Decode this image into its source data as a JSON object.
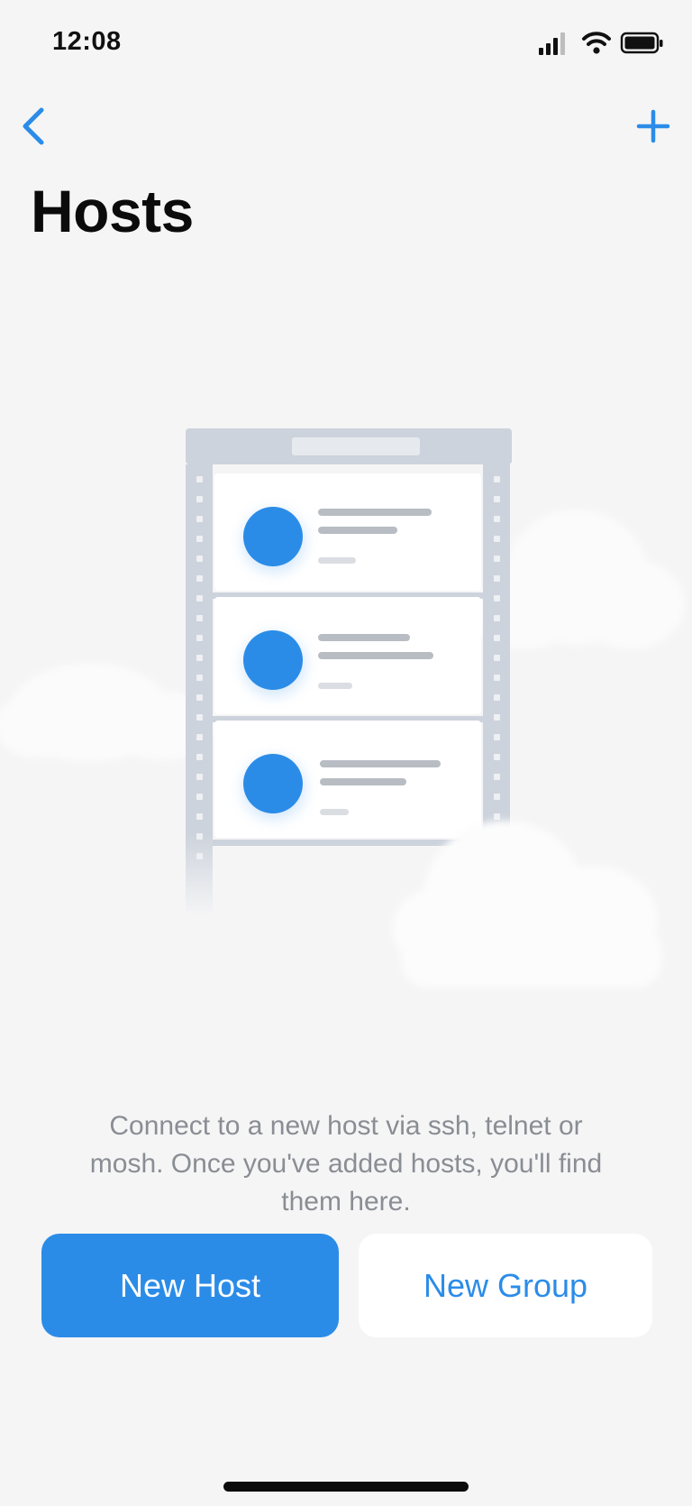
{
  "status_bar": {
    "time": "12:08",
    "icons": [
      "cellular-signal-icon",
      "wifi-icon",
      "battery-icon"
    ]
  },
  "nav": {
    "back_icon": "chevron-left-icon",
    "add_icon": "plus-icon"
  },
  "page": {
    "title": "Hosts"
  },
  "empty_state": {
    "illustration": "server-rack-illustration",
    "message": "Connect to a new host via ssh, telnet or mosh. Once you've added hosts, you'll find them here."
  },
  "actions": {
    "new_host_label": "New Host",
    "new_group_label": "New Group"
  },
  "colors": {
    "accent": "#2b8ce8",
    "background": "#f5f5f6",
    "muted_text": "#8a8d93",
    "rack": "#cdd3dc"
  }
}
